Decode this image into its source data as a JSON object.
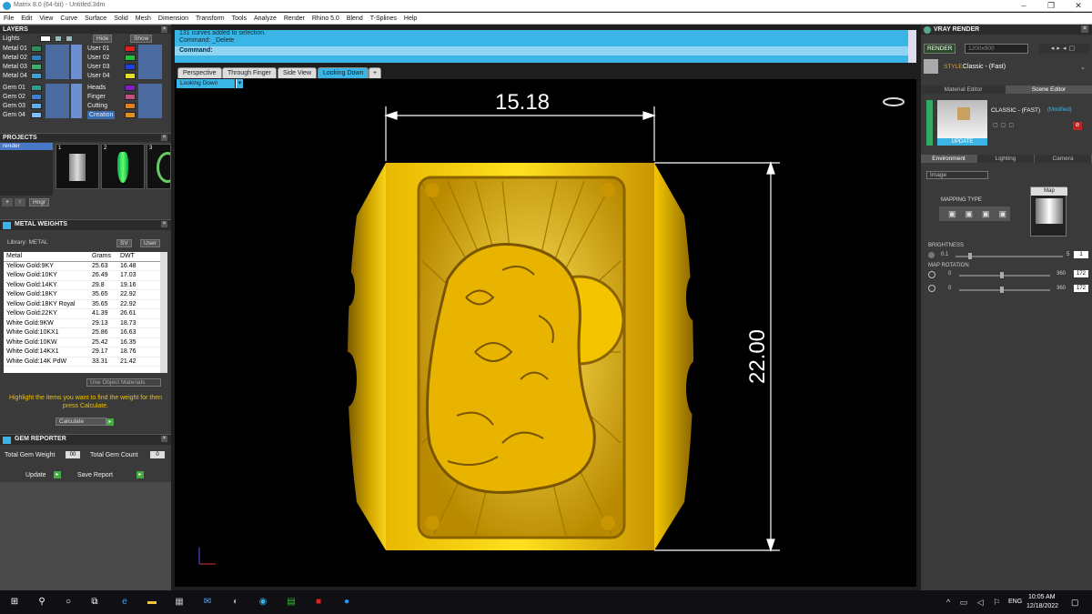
{
  "window": {
    "title": "Matrix 8.0 (64-bit) - Untitled.3dm"
  },
  "menu": [
    "File",
    "Edit",
    "View",
    "Curve",
    "Surface",
    "Solid",
    "Mesh",
    "Dimension",
    "Transform",
    "Tools",
    "Analyze",
    "Render",
    "Rhino 5.0",
    "Blend",
    "T-Splines",
    "Help"
  ],
  "layers": {
    "title": "LAYERS",
    "lights": "Lights",
    "hide": "Hide",
    "show": "Show",
    "left": [
      {
        "name": "Metal 01",
        "color": "#2f8f5f"
      },
      {
        "name": "Metal 02",
        "color": "#2f7fbf"
      },
      {
        "name": "Metal 03",
        "color": "#3faf6f"
      },
      {
        "name": "Metal 04",
        "color": "#3fa0cf"
      },
      {
        "name": "Gem 01",
        "color": "#2fa08f"
      },
      {
        "name": "Gem 02",
        "color": "#3f7fcf"
      },
      {
        "name": "Gem 03",
        "color": "#5fafef"
      },
      {
        "name": "Gem 04",
        "color": "#7fbfff"
      }
    ],
    "right": [
      {
        "name": "User 01",
        "color": "#e02020"
      },
      {
        "name": "User 02",
        "color": "#20c040"
      },
      {
        "name": "User 03",
        "color": "#2040e0"
      },
      {
        "name": "User 04",
        "color": "#e0e020"
      },
      {
        "name": "Heads",
        "color": "#8020c0"
      },
      {
        "name": "Finger",
        "color": "#c05080"
      },
      {
        "name": "Cutting",
        "color": "#e08020"
      },
      {
        "name": "Creation",
        "color": "#e09020"
      }
    ]
  },
  "projects": {
    "title": "PROJECTS",
    "item": "render",
    "thumbs": [
      "1",
      "2",
      "3"
    ],
    "hinge": "Hngr"
  },
  "metal_weights": {
    "title": "METAL WEIGHTS",
    "library": "Library: METAL",
    "sv": "SV",
    "user": "User",
    "headers": [
      "Metal",
      "Grams",
      "DWT"
    ],
    "rows": [
      [
        "Yellow Gold:9KY",
        "25.63",
        "16.48"
      ],
      [
        "Yellow Gold:10KY",
        "26.49",
        "17.03"
      ],
      [
        "Yellow Gold:14KY",
        "29.8",
        "19.16"
      ],
      [
        "Yellow Gold:18KY",
        "35.65",
        "22.92"
      ],
      [
        "Yellow Gold:18KY Royal",
        "35.65",
        "22.92"
      ],
      [
        "Yellow Gold:22KY",
        "41.39",
        "26.61"
      ],
      [
        "White Gold:9KW",
        "29.13",
        "18.73"
      ],
      [
        "White Gold:10KX1",
        "25.86",
        "16.63"
      ],
      [
        "White Gold:10KW",
        "25.42",
        "16.35"
      ],
      [
        "White Gold:14KX1",
        "29.17",
        "18.76"
      ],
      [
        "White Gold:14K PdW",
        "33.31",
        "21.42"
      ]
    ],
    "use_obj": "Use Object Materials",
    "hint": "Highlight the items you want to find the weight for then press Calculate.",
    "calc": "Calculate"
  },
  "gem_reporter": {
    "title": "GEM REPORTER",
    "tgw": "Total Gem Weight",
    "tgw_val": "00",
    "tgc": "Total Gem Count",
    "tgc_val": "0",
    "update": "Update",
    "save": "Save Report"
  },
  "command": {
    "line1": "131 curves added to selection.",
    "line2": "Command: _Delete",
    "prompt": "Command:"
  },
  "viewtabs": [
    "Perspective",
    "Through Finger",
    "Side View",
    "Looking Down"
  ],
  "active_view": "Looking Down",
  "dims": {
    "width": "15.18",
    "height": "22.00"
  },
  "vray": {
    "title": "VRAY RENDER",
    "render": "RENDER",
    "size": "1200x900",
    "style_label": "STYLE:",
    "style": "Classic - (Fast)",
    "tab_mat": "Material Editor",
    "tab_scene": "Scene Editor",
    "preset": "CLASSIC - (FAST)",
    "modified": "(Modified)",
    "update": "UPDATE",
    "tabs": [
      "Environment",
      "Lighting",
      "Camera"
    ],
    "image": "Image",
    "mapping": "MAPPING TYPE",
    "map": "Map",
    "brightness": "BRIGHTNESS",
    "b_min": "0.1",
    "b_max": "5",
    "b_val": "1",
    "rotation": "MAP ROTATION",
    "r_min": "0",
    "r_max": "360",
    "r1": "172",
    "r2": "172"
  },
  "taskbar": {
    "lang": "ENG",
    "time": "10:05 AM",
    "date": "12/18/2022"
  }
}
